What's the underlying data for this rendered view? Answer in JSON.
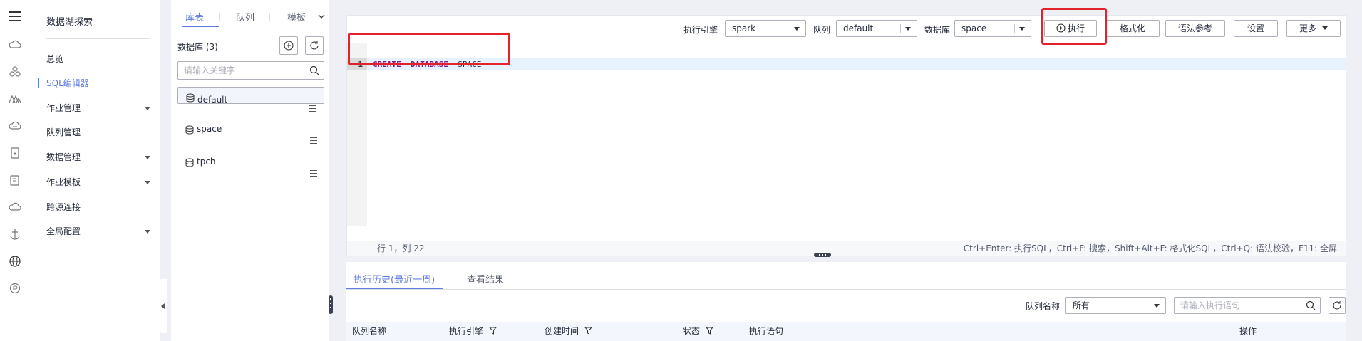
{
  "nav": {
    "title": "数据湖探索",
    "items": [
      {
        "label": "总览"
      },
      {
        "label": "SQL编辑器"
      },
      {
        "label": "作业管理"
      },
      {
        "label": "队列管理"
      },
      {
        "label": "数据管理"
      },
      {
        "label": "作业模板"
      },
      {
        "label": "跨源连接"
      },
      {
        "label": "全局配置"
      }
    ]
  },
  "db_panel": {
    "tabs": [
      "库表",
      "队列",
      "模板"
    ],
    "count_label": "数据库 (3)",
    "search_placeholder": "请输入关键字",
    "databases": [
      {
        "name": "default"
      },
      {
        "name": "space"
      },
      {
        "name": "tpch"
      }
    ]
  },
  "toolbar": {
    "engine_label": "执行引擎",
    "engine_value": "spark",
    "queue_label": "队列",
    "queue_value": "default",
    "database_label": "数据库",
    "database_value": "space",
    "execute": "执行",
    "format": "格式化",
    "syntax_ref": "语法参考",
    "settings": "设置",
    "more": "更多"
  },
  "editor": {
    "line_number": "1",
    "tokens": [
      "CREATE",
      "DATABASE",
      "SPACE"
    ],
    "position": "行 1，列 22",
    "shortcuts": "Ctrl+Enter: 执行SQL，Ctrl+F: 搜索，Shift+Alt+F: 格式化SQL，Ctrl+Q: 语法校验，F11: 全屏"
  },
  "results": {
    "tabs": [
      "执行历史(最近一周)",
      "查看结果"
    ],
    "queue_filter_label": "队列名称",
    "queue_filter_value": "所有",
    "search_placeholder": "请输入执行语句",
    "columns": [
      "队列名称",
      "执行引擎",
      "创建时间",
      "状态",
      "执行语句",
      "操作"
    ]
  },
  "colors": {
    "accent": "#5e7ce0",
    "highlight_box": "#e3222b",
    "keyword": "#7a1f85"
  }
}
